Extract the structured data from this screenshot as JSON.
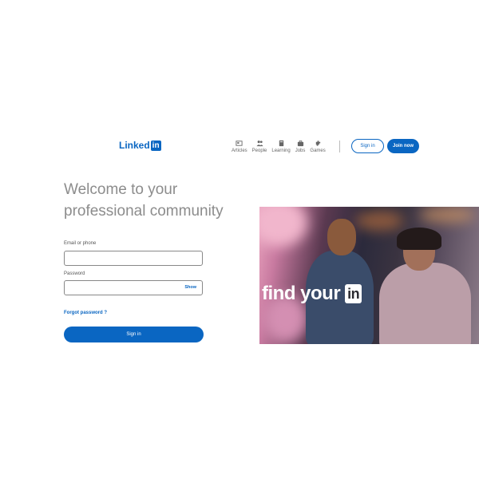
{
  "header": {
    "logo_text": "Linked",
    "logo_box": "in",
    "nav": [
      {
        "label": "Articles",
        "icon": "articles-icon"
      },
      {
        "label": "People",
        "icon": "people-icon"
      },
      {
        "label": "Learning",
        "icon": "learning-icon"
      },
      {
        "label": "Jobs",
        "icon": "jobs-icon"
      },
      {
        "label": "Games",
        "icon": "games-icon"
      }
    ],
    "sign_in_label": "Sign in",
    "join_label": "Join now"
  },
  "hero": {
    "headline": "Welcome to your professional community"
  },
  "form": {
    "email_label": "Email or phone",
    "email_value": "",
    "password_label": "Password",
    "password_value": "",
    "show_label": "Show",
    "forgot_label": "Forgot password ?",
    "submit_label": "Sign in"
  },
  "promo": {
    "text": "find your",
    "mark": "in"
  },
  "colors": {
    "brand": "#0a66c2",
    "headline": "#8c8c8c"
  }
}
